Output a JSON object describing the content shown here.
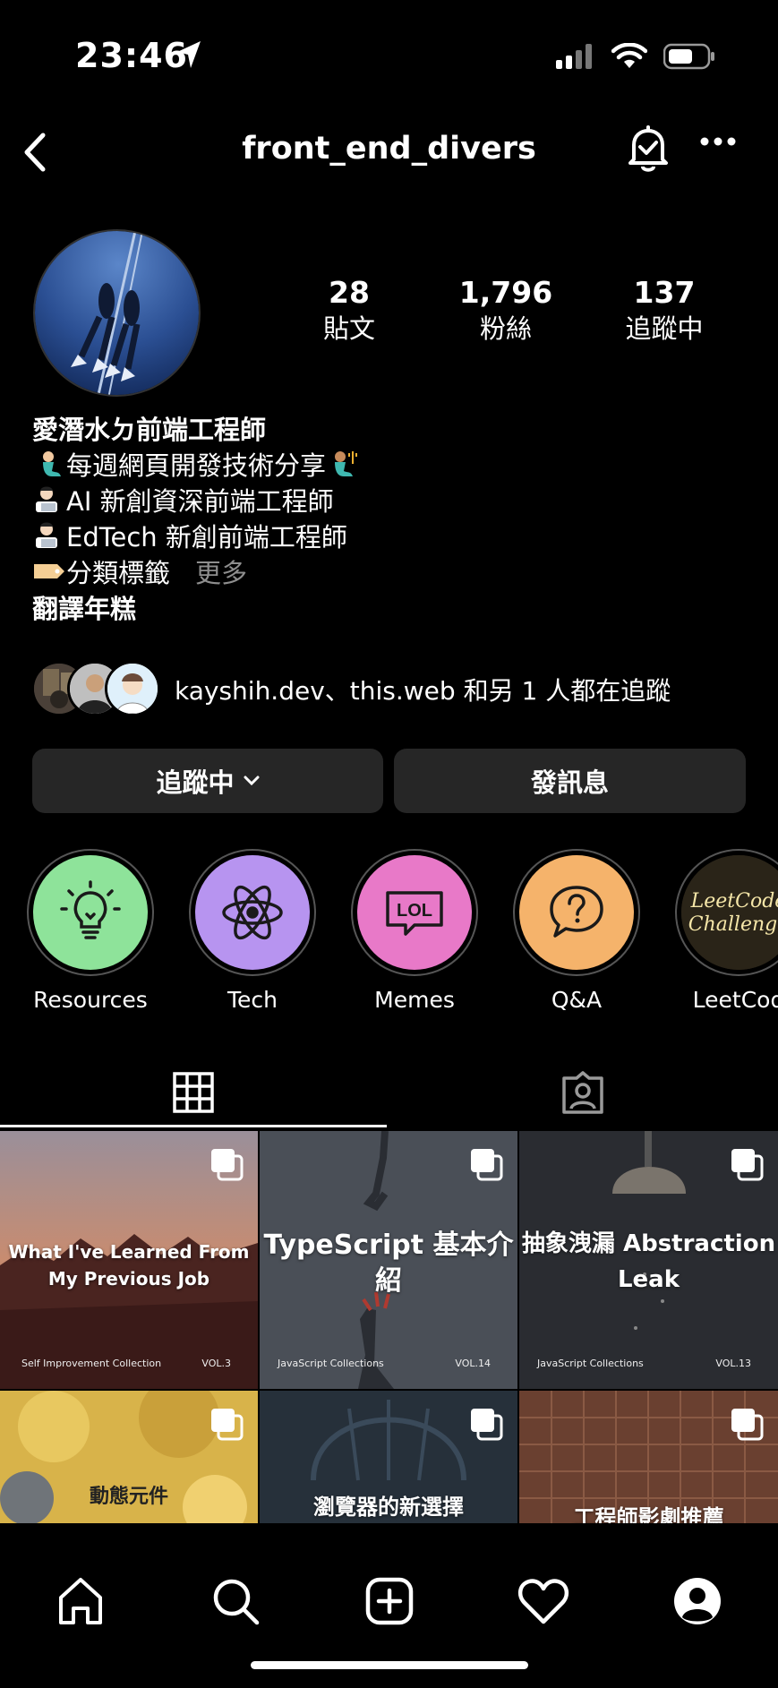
{
  "status_bar": {
    "time": "23:46"
  },
  "header": {
    "username": "front_end_divers"
  },
  "stats": [
    {
      "value": "28",
      "label": "貼文"
    },
    {
      "value": "1,796",
      "label": "粉絲"
    },
    {
      "value": "137",
      "label": "追蹤中"
    }
  ],
  "bio": {
    "name": "愛潛水ㄉ前端工程師",
    "lines": [
      "每週網頁開發技術分享",
      "AI 新創資深前端工程師",
      "EdTech 新創前端工程師",
      "分類標籤"
    ],
    "more_label": "更多",
    "translate_label": "翻譯年糕"
  },
  "mutual": {
    "text": "kayshih.dev、this.web 和另 1 人都在追蹤"
  },
  "buttons": {
    "following": "追蹤中",
    "message": "發訊息"
  },
  "highlights": [
    {
      "label": "Resources",
      "color": "#8ee39a",
      "icon": "lightbulb-icon"
    },
    {
      "label": "Tech",
      "color": "#b794f0",
      "icon": "atom-icon"
    },
    {
      "label": "Memes",
      "color": "#e879c8",
      "icon": "lol-icon"
    },
    {
      "label": "Q&A",
      "color": "#f5b36b",
      "icon": "question-bubble-icon"
    },
    {
      "label": "LeetCod",
      "color": "#2a2418",
      "icon": "leetcode-neon",
      "text": "LeetCode Challenge"
    }
  ],
  "posts": [
    {
      "title": "What I've Learned From My Previous Job",
      "collection": "Self Improvement Collection",
      "vol": "VOL.3"
    },
    {
      "title": "TypeScript 基本介紹",
      "collection": "JavaScript Collections",
      "vol": "VOL.14"
    },
    {
      "title": "抽象洩漏 Abstraction Leak",
      "collection": "JavaScript Collections",
      "vol": "VOL.13"
    },
    {
      "title": "動態元件"
    },
    {
      "title": "瀏覽器的新選擇"
    },
    {
      "title": "工程師影劇推薦"
    }
  ]
}
